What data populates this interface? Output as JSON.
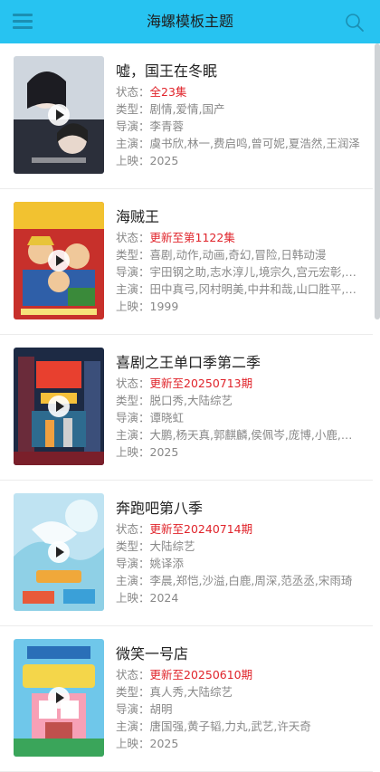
{
  "header": {
    "title": "海螺模板主题"
  },
  "labels": {
    "status": "状态：",
    "genre": "类型：",
    "director": "导演：",
    "cast": "主演：",
    "year": "上映："
  },
  "colors": {
    "header_bg": "#27c3f1",
    "status_red": "#e0242b",
    "meta_gray": "#888888"
  },
  "items": [
    {
      "title": "嘘，国王在冬眠",
      "status": "全23集",
      "genre": "剧情,爱情,国产",
      "director": "李青蓉",
      "cast": "虞书欣,林一,费启鸣,曾可妮,夏浩然,王润泽",
      "year": "2025"
    },
    {
      "title": "海贼王",
      "status": "更新至第1122集",
      "genre": "喜剧,动作,动画,奇幻,冒险,日韩动漫",
      "director": "宇田钢之助,志水淳儿,境宗久,宫元宏彰,五十岚卓哉",
      "cast": "田中真弓,冈村明美,中井和哉,山口胜平,平田广明",
      "year": "1999"
    },
    {
      "title": "喜剧之王单口季第二季",
      "status": "更新至20250713期",
      "genre": "脱口秀,大陆综艺",
      "director": "谭晓虹",
      "cast": "大鹏,杨天真,郭麒麟,侯佩岑,庞博,小鹿,付航",
      "year": "2025"
    },
    {
      "title": "奔跑吧第八季",
      "status": "更新至20240714期",
      "genre": "大陆综艺",
      "director": "姚译添",
      "cast": "李晨,郑恺,沙溢,白鹿,周深,范丞丞,宋雨琦",
      "year": "2024"
    },
    {
      "title": "微笑一号店",
      "status": "更新至20250610期",
      "genre": "真人秀,大陆综艺",
      "director": "胡明",
      "cast": "唐国强,黄子韬,力丸,武艺,许天奇",
      "year": "2025"
    }
  ]
}
